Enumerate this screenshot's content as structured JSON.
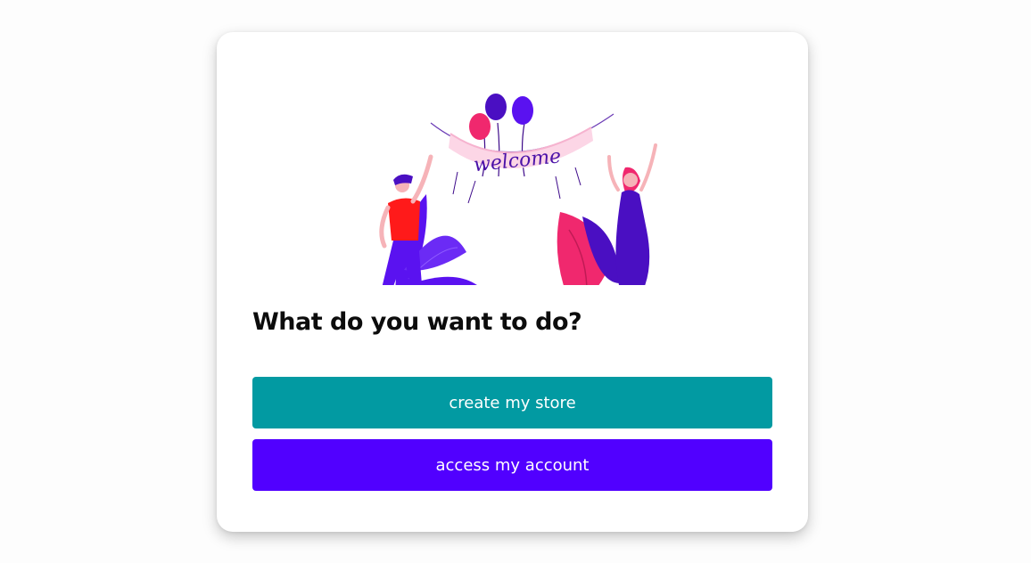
{
  "colors": {
    "primary_teal": "#029aa2",
    "primary_violet": "#5100ff",
    "card_bg": "#ffffff",
    "page_bg": "#fdfdfd"
  },
  "illustration": {
    "banner_text": "welcome",
    "icon": "welcome-party-illustration"
  },
  "prompt": {
    "title": "What do you want to do?"
  },
  "actions": {
    "create_store_label": "create my store",
    "access_account_label": "access my account"
  }
}
